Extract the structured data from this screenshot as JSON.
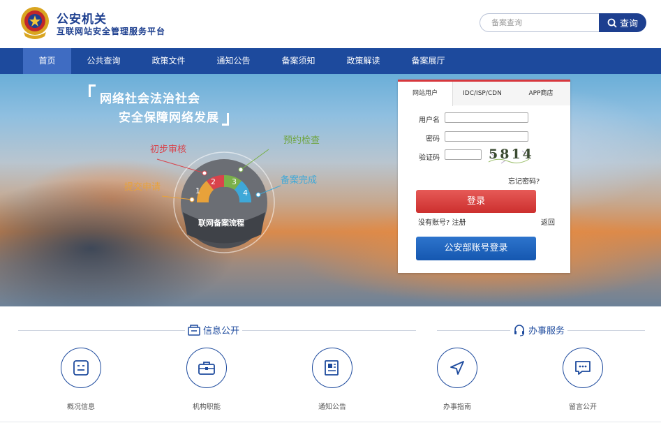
{
  "header": {
    "title": "公安机关",
    "subtitle": "互联网站安全管理服务平台",
    "search_placeholder": "备案查询",
    "search_button": "查询"
  },
  "nav": {
    "items": [
      {
        "label": "首页",
        "active": true
      },
      {
        "label": "公共查询"
      },
      {
        "label": "政策文件"
      },
      {
        "label": "通知公告"
      },
      {
        "label": "备案须知"
      },
      {
        "label": "政策解读"
      },
      {
        "label": "备案展厅"
      }
    ]
  },
  "hero": {
    "slogan_line1": "网络社会法治社会",
    "slogan_line2": "安全保障网络发展",
    "diagram": {
      "center": "联网备案流程",
      "steps": [
        {
          "num": "1",
          "label": "提交申请",
          "color": "#e8a23a"
        },
        {
          "num": "2",
          "label": "初步审核",
          "color": "#d9434b"
        },
        {
          "num": "3",
          "label": "预约检查",
          "color": "#7ab04a"
        },
        {
          "num": "4",
          "label": "备案完成",
          "color": "#3ea8d8"
        }
      ]
    }
  },
  "login": {
    "tabs": [
      "网站用户",
      "IDC/ISP/CDN",
      "APP商店"
    ],
    "username_label": "用户名",
    "password_label": "密码",
    "captcha_label": "验证码",
    "captcha_text": "5814",
    "forgot": "忘记密码?",
    "login_button": "登录",
    "no_account": "没有账号?",
    "register": "注册",
    "back": "返回",
    "police_login": "公安部账号登录"
  },
  "services": {
    "info_title": "信息公开",
    "service_title": "办事服务",
    "items": [
      {
        "label": "概况信息",
        "icon": "overview-icon"
      },
      {
        "label": "机构职能",
        "icon": "briefcase-icon"
      },
      {
        "label": "通知公告",
        "icon": "newspaper-icon"
      },
      {
        "label": "办事指南",
        "icon": "navigation-icon"
      },
      {
        "label": "留言公开",
        "icon": "message-icon"
      }
    ]
  },
  "colors": {
    "brand_blue": "#1d4a9d",
    "nav_active": "#3f6cc2",
    "accent_red": "#d7373d",
    "button_blue": "#1557b0"
  }
}
